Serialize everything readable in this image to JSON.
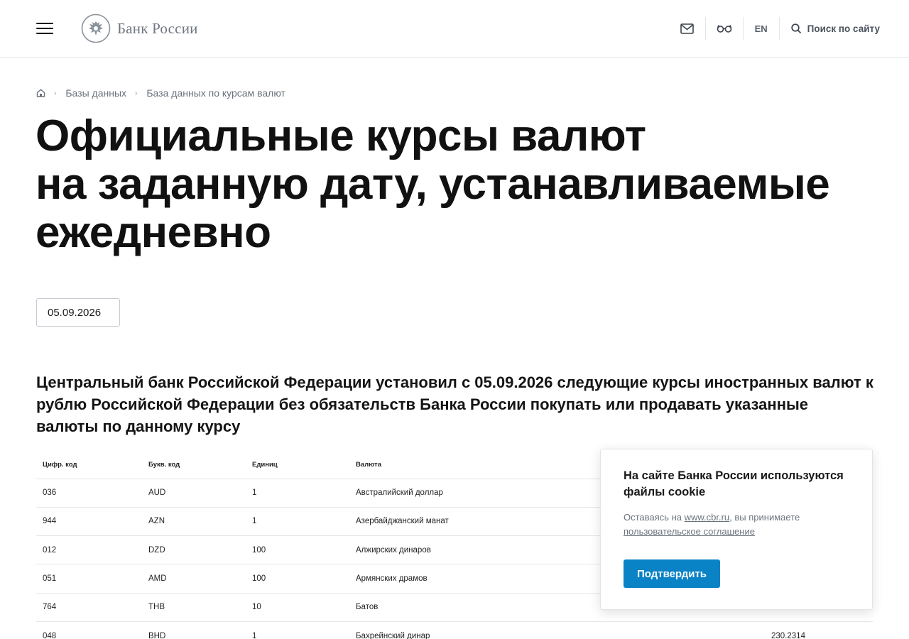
{
  "header": {
    "logo_text": "Банк России",
    "lang_label": "EN",
    "search_label": "Поиск по сайту"
  },
  "breadcrumb": [
    "Базы данных",
    "База данных по курсам валют"
  ],
  "title_lines": [
    "Официальные курсы валют",
    "на заданную дату, устанавливаемые",
    "ежедневно"
  ],
  "date_value": "05.09.2026",
  "lead_text": "Центральный банк Российской Федерации установил с 05.09.2026 следующие курсы иностранных валют к рублю Российской Федерации без обязательств Банка России покупать или продавать указанные валюты по данному курсу",
  "table": {
    "headers": [
      "Цифр. код",
      "Букв. код",
      "Единиц",
      "Валюта",
      ""
    ],
    "rows": [
      [
        "036",
        "AUD",
        "1",
        "Австралийский доллар",
        ""
      ],
      [
        "944",
        "AZN",
        "1",
        "Азербайджанский манат",
        ""
      ],
      [
        "012",
        "DZD",
        "100",
        "Алжирских динаров",
        ""
      ],
      [
        "051",
        "AMD",
        "100",
        "Армянских драмов",
        ""
      ],
      [
        "764",
        "THB",
        "10",
        "Батов",
        ""
      ],
      [
        "048",
        "BHD",
        "1",
        "Бахрейнский динар",
        "230.2314"
      ]
    ]
  },
  "cookie": {
    "title": "На сайте Банка России используются файлы cookie",
    "text_before": "Оставаясь на ",
    "site_link": "www.cbr.ru",
    "text_after": ", вы принимаете ",
    "agreement_link": "пользовательское соглашение",
    "confirm_label": "Подтвердить"
  },
  "colors": {
    "accent": "#0a82c6",
    "text": "#1a1a1a",
    "muted": "#6a737d"
  }
}
